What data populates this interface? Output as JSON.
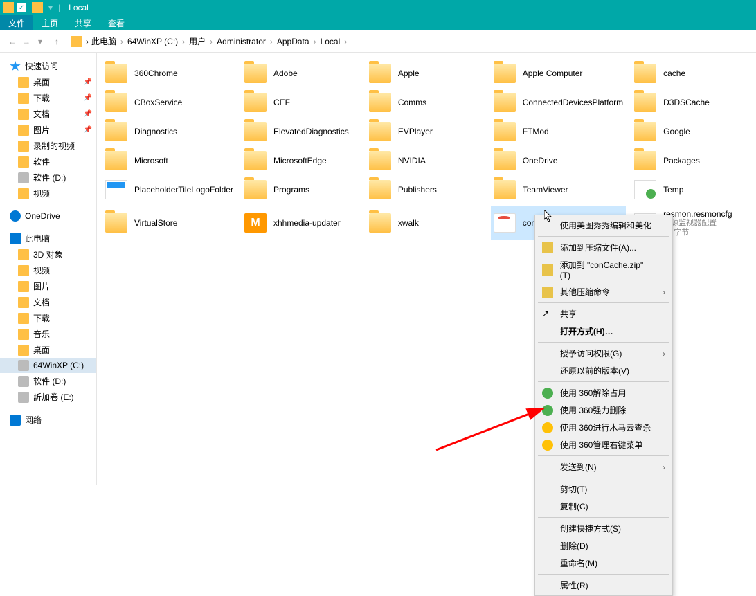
{
  "window": {
    "title": "Local",
    "tabs": [
      "文件",
      "主页",
      "共享",
      "查看"
    ]
  },
  "breadcrumb": [
    "此电脑",
    "64WinXP  (C:)",
    "用户",
    "Administrator",
    "AppData",
    "Local"
  ],
  "sidebar": {
    "quick_access": {
      "label": "快速访问",
      "items": [
        {
          "label": "桌面",
          "pinned": true
        },
        {
          "label": "下载",
          "pinned": true
        },
        {
          "label": "文档",
          "pinned": true
        },
        {
          "label": "图片",
          "pinned": true
        },
        {
          "label": "录制的视频",
          "pinned": false
        },
        {
          "label": "软件",
          "pinned": false
        },
        {
          "label": "软件 (D:)",
          "pinned": false
        },
        {
          "label": "视频",
          "pinned": false
        }
      ]
    },
    "onedrive": {
      "label": "OneDrive"
    },
    "this_pc": {
      "label": "此电脑",
      "items": [
        {
          "label": "3D 对象"
        },
        {
          "label": "视频"
        },
        {
          "label": "图片"
        },
        {
          "label": "文档"
        },
        {
          "label": "下载"
        },
        {
          "label": "音乐"
        },
        {
          "label": "桌面"
        },
        {
          "label": "64WinXP  (C:)",
          "selected": true
        },
        {
          "label": "软件 (D:)"
        },
        {
          "label": "訢加卷 (E:)"
        }
      ]
    },
    "network": {
      "label": "网络"
    }
  },
  "files": [
    {
      "label": "360Chrome",
      "type": "folder"
    },
    {
      "label": "Adobe",
      "type": "folder"
    },
    {
      "label": "Apple",
      "type": "folder"
    },
    {
      "label": "Apple Computer",
      "type": "folder"
    },
    {
      "label": "cache",
      "type": "folder"
    },
    {
      "label": "CBoxService",
      "type": "folder"
    },
    {
      "label": "CEF",
      "type": "folder"
    },
    {
      "label": "Comms",
      "type": "folder"
    },
    {
      "label": "ConnectedDevicesPlatform",
      "type": "folder"
    },
    {
      "label": "D3DSCache",
      "type": "folder"
    },
    {
      "label": "Diagnostics",
      "type": "folder"
    },
    {
      "label": "ElevatedDiagnostics",
      "type": "folder"
    },
    {
      "label": "EVPlayer",
      "type": "folder"
    },
    {
      "label": "FTMod",
      "type": "folder"
    },
    {
      "label": "Google",
      "type": "folder"
    },
    {
      "label": "Microsoft",
      "type": "folder"
    },
    {
      "label": "MicrosoftEdge",
      "type": "folder"
    },
    {
      "label": "NVIDIA",
      "type": "folder"
    },
    {
      "label": "OneDrive",
      "type": "folder"
    },
    {
      "label": "Packages",
      "type": "folder"
    },
    {
      "label": "PlaceholderTileLogoFolder",
      "type": "file-p"
    },
    {
      "label": "Programs",
      "type": "folder"
    },
    {
      "label": "Publishers",
      "type": "folder"
    },
    {
      "label": "TeamViewer",
      "type": "folder"
    },
    {
      "label": "Temp",
      "type": "file-t"
    },
    {
      "label": "VirtualStore",
      "type": "folder"
    },
    {
      "label": "xhhmedia-updater",
      "type": "file-m",
      "glyph": "M"
    },
    {
      "label": "xwalk",
      "type": "folder"
    },
    {
      "label": "conCache.db",
      "type": "file-db",
      "selected": true
    },
    {
      "label": "resmon.resmoncfg",
      "type": "file-cfg",
      "sub1": "资源监视器配置",
      "sub2": "17 字节"
    }
  ],
  "context_menu": [
    {
      "label": "使用美图秀秀编辑和美化",
      "icon": ""
    },
    {
      "sep": true
    },
    {
      "label": "添加到压缩文件(A)...",
      "icon": "zip"
    },
    {
      "label": "添加到 \"conCache.zip\" (T)",
      "icon": "zip"
    },
    {
      "label": "其他压缩命令",
      "icon": "zip",
      "sub": true
    },
    {
      "sep": true
    },
    {
      "label": "共享",
      "icon": "share",
      "glyph": "↗"
    },
    {
      "label": "打开方式(H)…",
      "bold": true
    },
    {
      "sep": true
    },
    {
      "label": "授予访问权限(G)",
      "sub": true
    },
    {
      "label": "还原以前的版本(V)"
    },
    {
      "sep": true
    },
    {
      "label": "使用 360解除占用",
      "icon": "g360"
    },
    {
      "label": "使用 360强力删除",
      "icon": "g360"
    },
    {
      "label": "使用 360进行木马云查杀",
      "icon": "y360"
    },
    {
      "label": "使用 360管理右键菜单",
      "icon": "y360"
    },
    {
      "sep": true
    },
    {
      "label": "发送到(N)",
      "sub": true
    },
    {
      "sep": true
    },
    {
      "label": "剪切(T)"
    },
    {
      "label": "复制(C)"
    },
    {
      "sep": true
    },
    {
      "label": "创建快捷方式(S)"
    },
    {
      "label": "删除(D)"
    },
    {
      "label": "重命名(M)"
    },
    {
      "sep": true
    },
    {
      "label": "属性(R)"
    }
  ]
}
